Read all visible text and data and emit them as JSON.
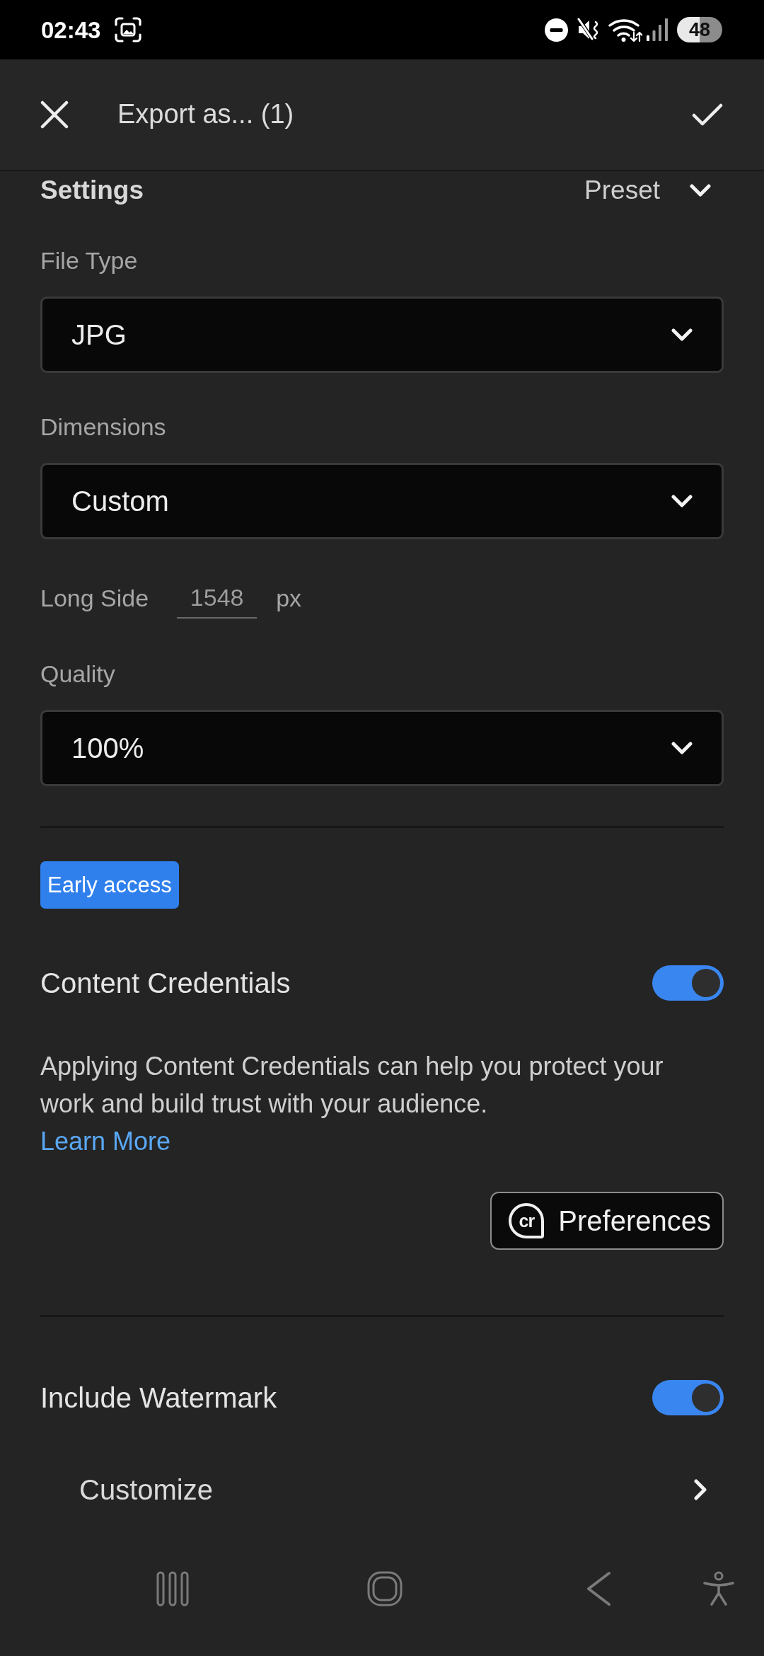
{
  "status_bar": {
    "time": "02:43",
    "battery": "48"
  },
  "header": {
    "title": "Export as... (1)"
  },
  "settings": {
    "title": "Settings",
    "preset": "Preset"
  },
  "fields": [
    {
      "kind": "select",
      "label": "File Type",
      "value": "JPG"
    },
    {
      "kind": "select",
      "label": "Dimensions",
      "value": "Custom"
    },
    {
      "kind": "number",
      "label": "Long Side",
      "value": "1548",
      "unit": "px"
    },
    {
      "kind": "select",
      "label": "Quality",
      "value": "100%"
    }
  ],
  "content_credentials": {
    "badge": "Early access",
    "title": "Content Credentials",
    "on": true,
    "description": "Applying Content Credentials can help you protect your work and build trust with your audience.",
    "link": "Learn More",
    "button": {
      "icon": "cr",
      "label": "Preferences"
    }
  },
  "watermark": {
    "title": "Include Watermark",
    "on": true,
    "customize": "Customize"
  }
}
